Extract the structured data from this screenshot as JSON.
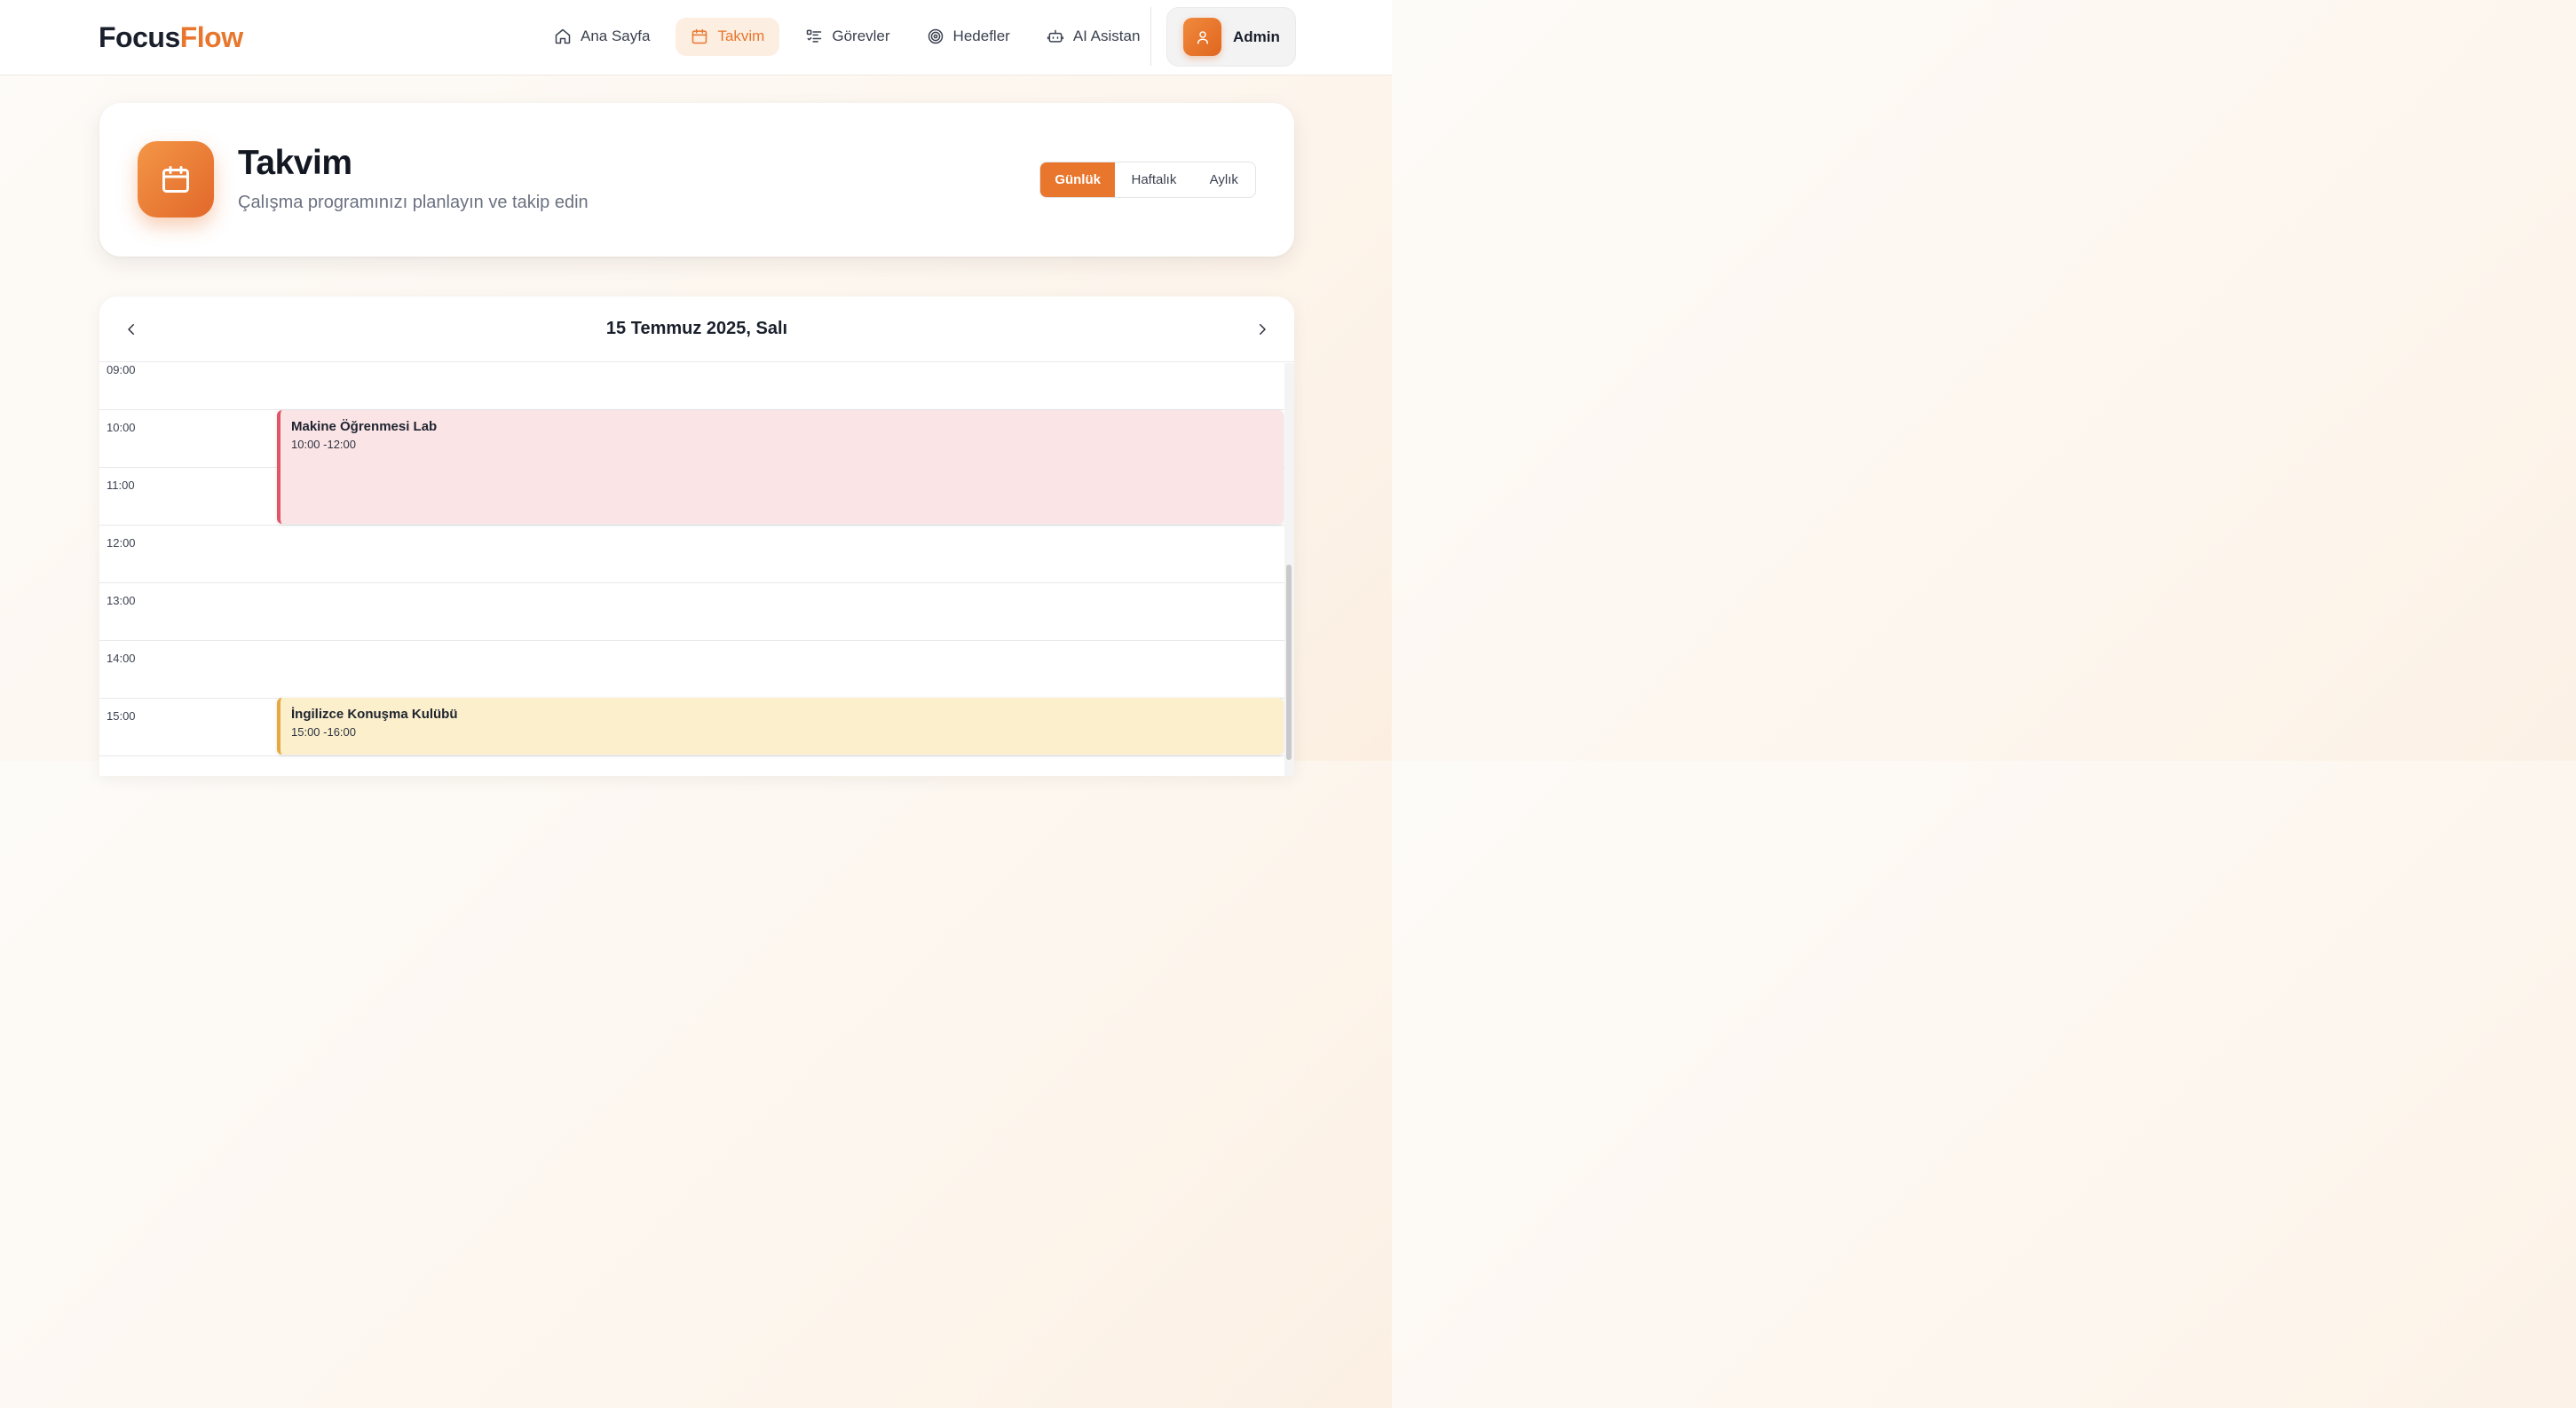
{
  "brand": {
    "part1": "Focus",
    "part2": "Flow"
  },
  "nav": {
    "items": [
      {
        "label": "Ana Sayfa",
        "icon": "home-icon"
      },
      {
        "label": "Takvim",
        "icon": "calendar-icon",
        "active": true
      },
      {
        "label": "Görevler",
        "icon": "task-list-icon"
      },
      {
        "label": "Hedefler",
        "icon": "target-icon"
      },
      {
        "label": "AI Asistan",
        "icon": "robot-icon"
      }
    ]
  },
  "user": {
    "name": "Admin",
    "icon": "user-icon"
  },
  "page": {
    "title": "Takvim",
    "subtitle": "Çalışma programınızı planlayın ve takip edin",
    "icon": "calendar-icon"
  },
  "view_toggle": {
    "daily": "Günlük",
    "weekly": "Haftalık",
    "monthly": "Aylık",
    "selected": "Günlük"
  },
  "calendar": {
    "date_label": "15 Temmuz 2025, Salı",
    "hours": [
      "09:00",
      "10:00",
      "11:00",
      "12:00",
      "13:00",
      "14:00",
      "15:00"
    ],
    "events": [
      {
        "title": "Makine Öğrenmesi Lab",
        "time": "10:00 -12:00",
        "start": "10:00",
        "end": "12:00",
        "color": "#e25566"
      },
      {
        "title": "İngilizce Konuşma Kulübü",
        "time": "15:00 -16:00",
        "start": "15:00",
        "end": "16:00",
        "color": "#e7a93e"
      }
    ]
  },
  "colors": {
    "accent": "#e8762d",
    "dark": "#1a1f2c"
  }
}
